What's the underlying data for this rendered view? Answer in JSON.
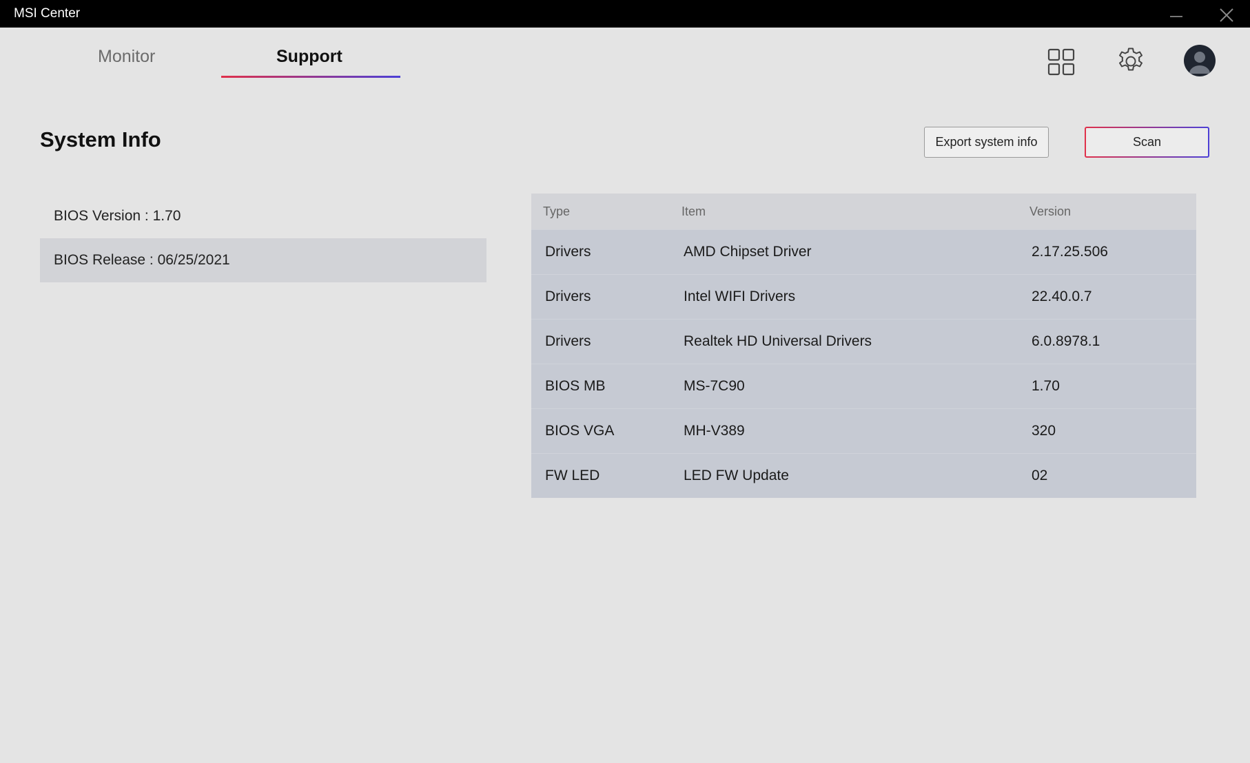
{
  "window": {
    "title": "MSI Center"
  },
  "tabs": [
    {
      "label": "Monitor",
      "active": false
    },
    {
      "label": "Support",
      "active": true
    }
  ],
  "header_icons": [
    "apps-grid-icon",
    "gear-icon",
    "user-avatar"
  ],
  "system_info": {
    "title": "System Info",
    "export_label": "Export system info",
    "scan_label": "Scan",
    "bios_version": "BIOS Version : 1.70",
    "bios_release": "BIOS Release : 06/25/2021"
  },
  "table": {
    "headers": [
      "Type",
      "Item",
      "Version"
    ],
    "rows": [
      [
        "Drivers",
        "AMD Chipset Driver",
        "2.17.25.506"
      ],
      [
        "Drivers",
        "Intel WIFI Drivers",
        "22.40.0.7"
      ],
      [
        "Drivers",
        "Realtek HD Universal Drivers",
        "6.0.8978.1"
      ],
      [
        "BIOS MB",
        "MS-7C90",
        "1.70"
      ],
      [
        "BIOS VGA",
        "MH-V389",
        "320"
      ],
      [
        "FW LED",
        "LED FW Update",
        "02"
      ]
    ]
  },
  "colors": {
    "accent_start": "#e0304a",
    "accent_end": "#4b3fd6",
    "background": "#e4e4e4",
    "table_row": "#c6cad3"
  }
}
